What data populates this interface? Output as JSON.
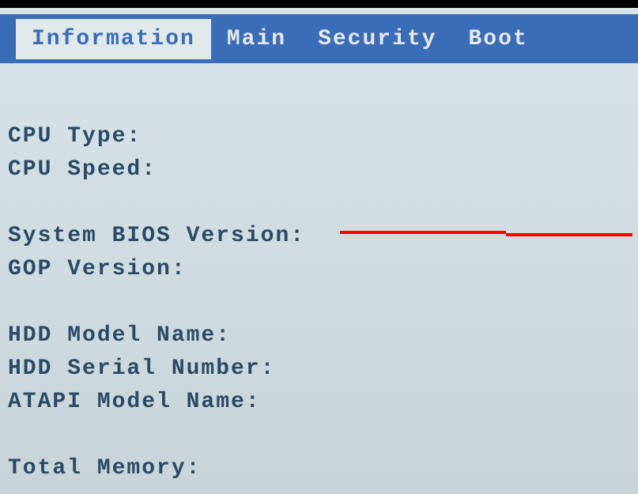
{
  "tabs": {
    "information": "Information",
    "main": "Main",
    "security": "Security",
    "boot": "Boot"
  },
  "fields": {
    "cpu_type": "CPU Type:",
    "cpu_speed": "CPU Speed:",
    "system_bios_version": "System BIOS Version:",
    "gop_version": "GOP Version:",
    "hdd_model_name": "HDD Model Name:",
    "hdd_serial_number": "HDD Serial Number:",
    "atapi_model_name": "ATAPI Model Name:",
    "total_memory": "Total Memory:"
  },
  "annotation": {
    "arrow_color": "#ff0000"
  }
}
